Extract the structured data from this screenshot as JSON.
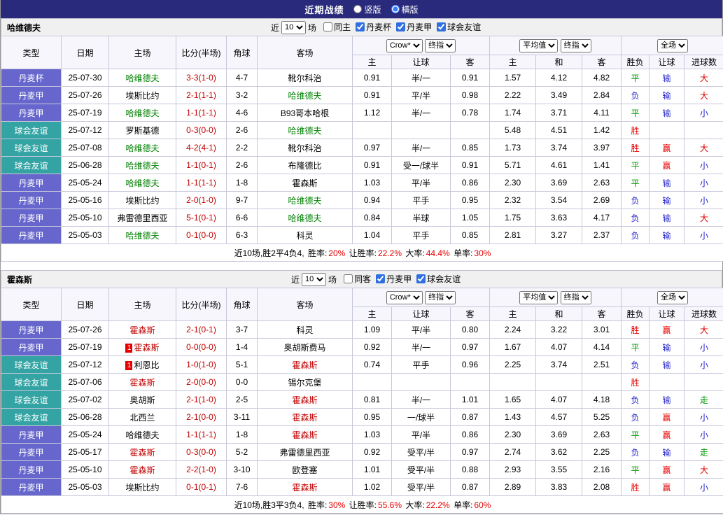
{
  "title_bar": {
    "title": "近期战绩",
    "options": [
      {
        "label": "竖版",
        "selected": false
      },
      {
        "label": "横版",
        "selected": true
      }
    ]
  },
  "colors": {
    "titlebar_bg": "#2a2a7c",
    "type_league": "#6666cc",
    "type_friendly": "#33a3a3",
    "focal_team_section1": "#008000",
    "focal_team_section2": "#c00000",
    "score": "#c00000",
    "result_win": "#e60000",
    "result_draw": "#009900",
    "result_lose": "#2222cc",
    "summary_value": "#e60000",
    "card_badge": "#e60000"
  },
  "filter_labels": {
    "pre": "近",
    "post": "场"
  },
  "dropdowns": {
    "bookmaker": "Crow*",
    "asia_scope": "终指",
    "euro_source": "平均值",
    "euro_scope": "终指",
    "match_scope": "全场"
  },
  "table_columns": {
    "type": "类型",
    "date": "日期",
    "home": "主场",
    "score": "比分(半场)",
    "corners": "角球",
    "away": "客场",
    "asia_home": "主",
    "asia_handicap": "让球",
    "asia_away": "客",
    "euro_home": "主",
    "euro_draw": "和",
    "euro_away": "客",
    "result_wdl": "胜负",
    "result_handicap": "让球",
    "result_goals": "进球数"
  },
  "sections": [
    {
      "team": "哈维德夫",
      "focal_color_key": "focal_team_section1",
      "filter": {
        "recent_value": "10",
        "checkboxes": [
          {
            "label": "同主",
            "checked": false
          },
          {
            "label": "丹麦杯",
            "checked": true
          },
          {
            "label": "丹麦甲",
            "checked": true
          },
          {
            "label": "球会友谊",
            "checked": true
          }
        ]
      },
      "rows": [
        {
          "type": "丹麦杯",
          "type_key": "type_league",
          "date": "25-07-30",
          "home": {
            "name": "哈维德夫",
            "focal": true
          },
          "score": "3-3(1-0)",
          "corners": "4-7",
          "away": {
            "name": "靴尔科治",
            "focal": false
          },
          "asia": [
            "0.91",
            "半/一",
            "0.91"
          ],
          "euro": [
            "1.57",
            "4.12",
            "4.82"
          ],
          "results": [
            {
              "text": "平",
              "key": "result_draw"
            },
            {
              "text": "输",
              "key": "result_lose"
            },
            {
              "text": "大",
              "key": "result_win"
            }
          ]
        },
        {
          "type": "丹麦甲",
          "type_key": "type_league",
          "date": "25-07-26",
          "home": {
            "name": "埃斯比约",
            "focal": false
          },
          "score": "2-1(1-1)",
          "corners": "3-2",
          "away": {
            "name": "哈维德夫",
            "focal": true
          },
          "asia": [
            "0.91",
            "平/半",
            "0.98"
          ],
          "euro": [
            "2.22",
            "3.49",
            "2.84"
          ],
          "results": [
            {
              "text": "负",
              "key": "result_lose"
            },
            {
              "text": "输",
              "key": "result_lose"
            },
            {
              "text": "大",
              "key": "result_win"
            }
          ]
        },
        {
          "type": "丹麦甲",
          "type_key": "type_league",
          "date": "25-07-19",
          "home": {
            "name": "哈维德夫",
            "focal": true
          },
          "score": "1-1(1-1)",
          "corners": "4-6",
          "away": {
            "name": "B93哥本哈根",
            "focal": false
          },
          "asia": [
            "1.12",
            "半/一",
            "0.78"
          ],
          "euro": [
            "1.74",
            "3.71",
            "4.11"
          ],
          "results": [
            {
              "text": "平",
              "key": "result_draw"
            },
            {
              "text": "输",
              "key": "result_lose"
            },
            {
              "text": "小",
              "key": "result_lose"
            }
          ]
        },
        {
          "type": "球会友谊",
          "type_key": "type_friendly",
          "date": "25-07-12",
          "home": {
            "name": "罗斯基德",
            "focal": false
          },
          "score": "0-3(0-0)",
          "corners": "2-6",
          "away": {
            "name": "哈维德夫",
            "focal": true
          },
          "asia": [
            "",
            "",
            ""
          ],
          "euro": [
            "5.48",
            "4.51",
            "1.42"
          ],
          "results": [
            {
              "text": "胜",
              "key": "result_win"
            },
            {
              "text": "",
              "key": ""
            },
            {
              "text": "",
              "key": ""
            }
          ]
        },
        {
          "type": "球会友谊",
          "type_key": "type_friendly",
          "date": "25-07-08",
          "home": {
            "name": "哈维德夫",
            "focal": true
          },
          "score": "4-2(4-1)",
          "corners": "2-2",
          "away": {
            "name": "靴尔科治",
            "focal": false
          },
          "asia": [
            "0.97",
            "半/一",
            "0.85"
          ],
          "euro": [
            "1.73",
            "3.74",
            "3.97"
          ],
          "results": [
            {
              "text": "胜",
              "key": "result_win"
            },
            {
              "text": "赢",
              "key": "result_win"
            },
            {
              "text": "大",
              "key": "result_win"
            }
          ]
        },
        {
          "type": "球会友谊",
          "type_key": "type_friendly",
          "date": "25-06-28",
          "home": {
            "name": "哈维德夫",
            "focal": true
          },
          "score": "1-1(0-1)",
          "corners": "2-6",
          "away": {
            "name": "布隆德比",
            "focal": false
          },
          "asia": [
            "0.91",
            "受一/球半",
            "0.91"
          ],
          "euro": [
            "5.71",
            "4.61",
            "1.41"
          ],
          "results": [
            {
              "text": "平",
              "key": "result_draw"
            },
            {
              "text": "赢",
              "key": "result_win"
            },
            {
              "text": "小",
              "key": "result_lose"
            }
          ]
        },
        {
          "type": "丹麦甲",
          "type_key": "type_league",
          "date": "25-05-24",
          "home": {
            "name": "哈维德夫",
            "focal": true
          },
          "score": "1-1(1-1)",
          "corners": "1-8",
          "away": {
            "name": "霍森斯",
            "focal": false
          },
          "asia": [
            "1.03",
            "平/半",
            "0.86"
          ],
          "euro": [
            "2.30",
            "3.69",
            "2.63"
          ],
          "results": [
            {
              "text": "平",
              "key": "result_draw"
            },
            {
              "text": "输",
              "key": "result_lose"
            },
            {
              "text": "小",
              "key": "result_lose"
            }
          ]
        },
        {
          "type": "丹麦甲",
          "type_key": "type_league",
          "date": "25-05-16",
          "home": {
            "name": "埃斯比约",
            "focal": false
          },
          "score": "2-0(1-0)",
          "corners": "9-7",
          "away": {
            "name": "哈维德夫",
            "focal": true
          },
          "asia": [
            "0.94",
            "平手",
            "0.95"
          ],
          "euro": [
            "2.32",
            "3.54",
            "2.69"
          ],
          "results": [
            {
              "text": "负",
              "key": "result_lose"
            },
            {
              "text": "输",
              "key": "result_lose"
            },
            {
              "text": "小",
              "key": "result_lose"
            }
          ]
        },
        {
          "type": "丹麦甲",
          "type_key": "type_league",
          "date": "25-05-10",
          "home": {
            "name": "弗雷德里西亚",
            "focal": false
          },
          "score": "5-1(0-1)",
          "corners": "6-6",
          "away": {
            "name": "哈维德夫",
            "focal": true
          },
          "asia": [
            "0.84",
            "半球",
            "1.05"
          ],
          "euro": [
            "1.75",
            "3.63",
            "4.17"
          ],
          "results": [
            {
              "text": "负",
              "key": "result_lose"
            },
            {
              "text": "输",
              "key": "result_lose"
            },
            {
              "text": "大",
              "key": "result_win"
            }
          ]
        },
        {
          "type": "丹麦甲",
          "type_key": "type_league",
          "date": "25-05-03",
          "home": {
            "name": "哈维德夫",
            "focal": true
          },
          "score": "0-1(0-0)",
          "corners": "6-3",
          "away": {
            "name": "科灵",
            "focal": false
          },
          "asia": [
            "1.04",
            "平手",
            "0.85"
          ],
          "euro": [
            "2.81",
            "3.27",
            "2.37"
          ],
          "results": [
            {
              "text": "负",
              "key": "result_lose"
            },
            {
              "text": "输",
              "key": "result_lose"
            },
            {
              "text": "小",
              "key": "result_lose"
            }
          ]
        }
      ],
      "summary": {
        "prefix": "近10场,胜2平4负4,",
        "stats": [
          {
            "label": "胜率:",
            "value": "20%"
          },
          {
            "label": "让胜率:",
            "value": "22.2%"
          },
          {
            "label": "大率:",
            "value": "44.4%"
          },
          {
            "label": "单率:",
            "value": "30%"
          }
        ]
      }
    },
    {
      "team": "霍森斯",
      "focal_color_key": "focal_team_section2",
      "filter": {
        "recent_value": "10",
        "checkboxes": [
          {
            "label": "同客",
            "checked": false
          },
          {
            "label": "丹麦甲",
            "checked": true
          },
          {
            "label": "球会友谊",
            "checked": true
          }
        ]
      },
      "rows": [
        {
          "type": "丹麦甲",
          "type_key": "type_league",
          "date": "25-07-26",
          "home": {
            "name": "霍森斯",
            "focal": true
          },
          "score": "2-1(0-1)",
          "corners": "3-7",
          "away": {
            "name": "科灵",
            "focal": false
          },
          "asia": [
            "1.09",
            "平/半",
            "0.80"
          ],
          "euro": [
            "2.24",
            "3.22",
            "3.01"
          ],
          "results": [
            {
              "text": "胜",
              "key": "result_win"
            },
            {
              "text": "赢",
              "key": "result_win"
            },
            {
              "text": "大",
              "key": "result_win"
            }
          ]
        },
        {
          "type": "丹麦甲",
          "type_key": "type_league",
          "date": "25-07-19",
          "home": {
            "name": "霍森斯",
            "focal": true,
            "card": "1"
          },
          "score": "0-0(0-0)",
          "corners": "1-4",
          "away": {
            "name": "奥胡斯费马",
            "focal": false
          },
          "asia": [
            "0.92",
            "半/一",
            "0.97"
          ],
          "euro": [
            "1.67",
            "4.07",
            "4.14"
          ],
          "results": [
            {
              "text": "平",
              "key": "result_draw"
            },
            {
              "text": "输",
              "key": "result_lose"
            },
            {
              "text": "小",
              "key": "result_lose"
            }
          ]
        },
        {
          "type": "球会友谊",
          "type_key": "type_friendly",
          "date": "25-07-12",
          "home": {
            "name": "利恩比",
            "focal": false,
            "card": "1"
          },
          "score": "1-0(1-0)",
          "corners": "5-1",
          "away": {
            "name": "霍森斯",
            "focal": true
          },
          "asia": [
            "0.74",
            "平手",
            "0.96"
          ],
          "euro": [
            "2.25",
            "3.74",
            "2.51"
          ],
          "results": [
            {
              "text": "负",
              "key": "result_lose"
            },
            {
              "text": "输",
              "key": "result_lose"
            },
            {
              "text": "小",
              "key": "result_lose"
            }
          ]
        },
        {
          "type": "球会友谊",
          "type_key": "type_friendly",
          "date": "25-07-06",
          "home": {
            "name": "霍森斯",
            "focal": true
          },
          "score": "2-0(0-0)",
          "corners": "0-0",
          "away": {
            "name": "锡尔克堡",
            "focal": false
          },
          "asia": [
            "",
            "",
            ""
          ],
          "euro": [
            "",
            "",
            ""
          ],
          "results": [
            {
              "text": "胜",
              "key": "result_win"
            },
            {
              "text": "",
              "key": ""
            },
            {
              "text": "",
              "key": ""
            }
          ]
        },
        {
          "type": "球会友谊",
          "type_key": "type_friendly",
          "date": "25-07-02",
          "home": {
            "name": "奥胡斯",
            "focal": false
          },
          "score": "2-1(1-0)",
          "corners": "2-5",
          "away": {
            "name": "霍森斯",
            "focal": true
          },
          "asia": [
            "0.81",
            "半/一",
            "1.01"
          ],
          "euro": [
            "1.65",
            "4.07",
            "4.18"
          ],
          "results": [
            {
              "text": "负",
              "key": "result_lose"
            },
            {
              "text": "输",
              "key": "result_lose"
            },
            {
              "text": "走",
              "key": "result_draw"
            }
          ]
        },
        {
          "type": "球会友谊",
          "type_key": "type_friendly",
          "date": "25-06-28",
          "home": {
            "name": "北西兰",
            "focal": false
          },
          "score": "2-1(0-0)",
          "corners": "3-11",
          "away": {
            "name": "霍森斯",
            "focal": true
          },
          "asia": [
            "0.95",
            "一/球半",
            "0.87"
          ],
          "euro": [
            "1.43",
            "4.57",
            "5.25"
          ],
          "results": [
            {
              "text": "负",
              "key": "result_lose"
            },
            {
              "text": "赢",
              "key": "result_win"
            },
            {
              "text": "小",
              "key": "result_lose"
            }
          ]
        },
        {
          "type": "丹麦甲",
          "type_key": "type_league",
          "date": "25-05-24",
          "home": {
            "name": "哈维德夫",
            "focal": false
          },
          "score": "1-1(1-1)",
          "corners": "1-8",
          "away": {
            "name": "霍森斯",
            "focal": true
          },
          "asia": [
            "1.03",
            "平/半",
            "0.86"
          ],
          "euro": [
            "2.30",
            "3.69",
            "2.63"
          ],
          "results": [
            {
              "text": "平",
              "key": "result_draw"
            },
            {
              "text": "赢",
              "key": "result_win"
            },
            {
              "text": "小",
              "key": "result_lose"
            }
          ]
        },
        {
          "type": "丹麦甲",
          "type_key": "type_league",
          "date": "25-05-17",
          "home": {
            "name": "霍森斯",
            "focal": true
          },
          "score": "0-3(0-0)",
          "corners": "5-2",
          "away": {
            "name": "弗雷德里西亚",
            "focal": false
          },
          "asia": [
            "0.92",
            "受平/半",
            "0.97"
          ],
          "euro": [
            "2.74",
            "3.62",
            "2.25"
          ],
          "results": [
            {
              "text": "负",
              "key": "result_lose"
            },
            {
              "text": "输",
              "key": "result_lose"
            },
            {
              "text": "走",
              "key": "result_draw"
            }
          ]
        },
        {
          "type": "丹麦甲",
          "type_key": "type_league",
          "date": "25-05-10",
          "home": {
            "name": "霍森斯",
            "focal": true
          },
          "score": "2-2(1-0)",
          "corners": "3-10",
          "away": {
            "name": "欧登塞",
            "focal": false
          },
          "asia": [
            "1.01",
            "受平/半",
            "0.88"
          ],
          "euro": [
            "2.93",
            "3.55",
            "2.16"
          ],
          "results": [
            {
              "text": "平",
              "key": "result_draw"
            },
            {
              "text": "赢",
              "key": "result_win"
            },
            {
              "text": "大",
              "key": "result_win"
            }
          ]
        },
        {
          "type": "丹麦甲",
          "type_key": "type_league",
          "date": "25-05-03",
          "home": {
            "name": "埃斯比约",
            "focal": false
          },
          "score": "0-1(0-1)",
          "corners": "7-6",
          "away": {
            "name": "霍森斯",
            "focal": true
          },
          "asia": [
            "1.02",
            "受平/半",
            "0.87"
          ],
          "euro": [
            "2.89",
            "3.83",
            "2.08"
          ],
          "results": [
            {
              "text": "胜",
              "key": "result_win"
            },
            {
              "text": "赢",
              "key": "result_win"
            },
            {
              "text": "小",
              "key": "result_lose"
            }
          ]
        }
      ],
      "summary": {
        "prefix": "近10场,胜3平3负4,",
        "stats": [
          {
            "label": "胜率:",
            "value": "30%"
          },
          {
            "label": "让胜率:",
            "value": "55.6%"
          },
          {
            "label": "大率:",
            "value": "22.2%"
          },
          {
            "label": "单率:",
            "value": "60%"
          }
        ]
      }
    }
  ]
}
